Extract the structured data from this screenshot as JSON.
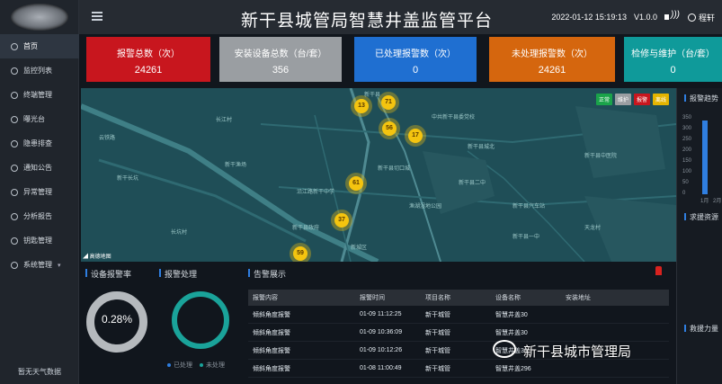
{
  "header": {
    "title": "新干县城管局智慧井盖监管平台",
    "datetime": "2022-01-12 15:19:13",
    "version": "V1.0.0",
    "user": "程轩"
  },
  "sidebar": {
    "items": [
      {
        "label": "首页"
      },
      {
        "label": "监控列表"
      },
      {
        "label": "终端管理"
      },
      {
        "label": "曝光台"
      },
      {
        "label": "隐患排查"
      },
      {
        "label": "通知公告"
      },
      {
        "label": "异常管理"
      },
      {
        "label": "分析报告"
      },
      {
        "label": "钥匙管理"
      },
      {
        "label": "系统管理"
      }
    ],
    "weather": "暂无天气数据"
  },
  "cards": [
    {
      "label": "报警总数（次）",
      "value": "24261",
      "color": "#c8161e"
    },
    {
      "label": "安装设备总数（台/套）",
      "value": "356",
      "color": "#9a9ea2"
    },
    {
      "label": "已处理报警数（次）",
      "value": "0",
      "color": "#1f6fd1"
    },
    {
      "label": "未处理报警数（次）",
      "value": "24261",
      "color": "#d5660e"
    },
    {
      "label": "检修与维护（台/套）",
      "value": "0",
      "color": "#0f9a9a"
    }
  ],
  "map": {
    "legend": [
      "正常",
      "维护",
      "报警",
      "离线"
    ],
    "markers": [
      "13",
      "71",
      "56",
      "17",
      "61",
      "37",
      "59"
    ],
    "labels": [
      "新干县",
      "中共新干县委党校",
      "新干县切口城",
      "沿江路新干中学",
      "新干县政府",
      "渔湖湿地公园",
      "新干县汽车站",
      "新干县城北",
      "云铁路",
      "新干长坑",
      "长江村",
      "新干渔场",
      "新干县二中",
      "新干县一中",
      "新干县中医院",
      "新城区",
      "长坑村",
      "天龙村",
      "新干县中医院"
    ],
    "attribution": "高德地图"
  },
  "right_panel": {
    "title1": "报警趋势",
    "title2": "求援资源",
    "title3": "救援力量",
    "y_ticks": [
      "350",
      "300",
      "250",
      "200",
      "150",
      "100",
      "50",
      "0"
    ],
    "x_ticks": [
      "1月",
      "2月"
    ]
  },
  "bottom": {
    "rate_title": "设备报警率",
    "rate_value": "0.28%",
    "handle_title": "报警处理",
    "handle_legend": [
      "已处理",
      "未处理"
    ],
    "alert_title": "告警展示",
    "table_headers": [
      "报警内容",
      "报警时间",
      "项目名称",
      "设备名称",
      "安装地址"
    ],
    "rows": [
      [
        "倾斜角度报警",
        "01-09 11:12:25",
        "新干城管",
        "智慧井盖30",
        ""
      ],
      [
        "倾斜角度报警",
        "01-09 10:36:09",
        "新干城管",
        "智慧井盖30",
        ""
      ],
      [
        "倾斜角度报警",
        "01-09 10:12:26",
        "新干城管",
        "智慧井盖30",
        ""
      ],
      [
        "倾斜角度报警",
        "01-08 11:00:49",
        "新干城管",
        "智慧井盖296",
        ""
      ]
    ]
  },
  "watermark": "新干县城市管理局"
}
